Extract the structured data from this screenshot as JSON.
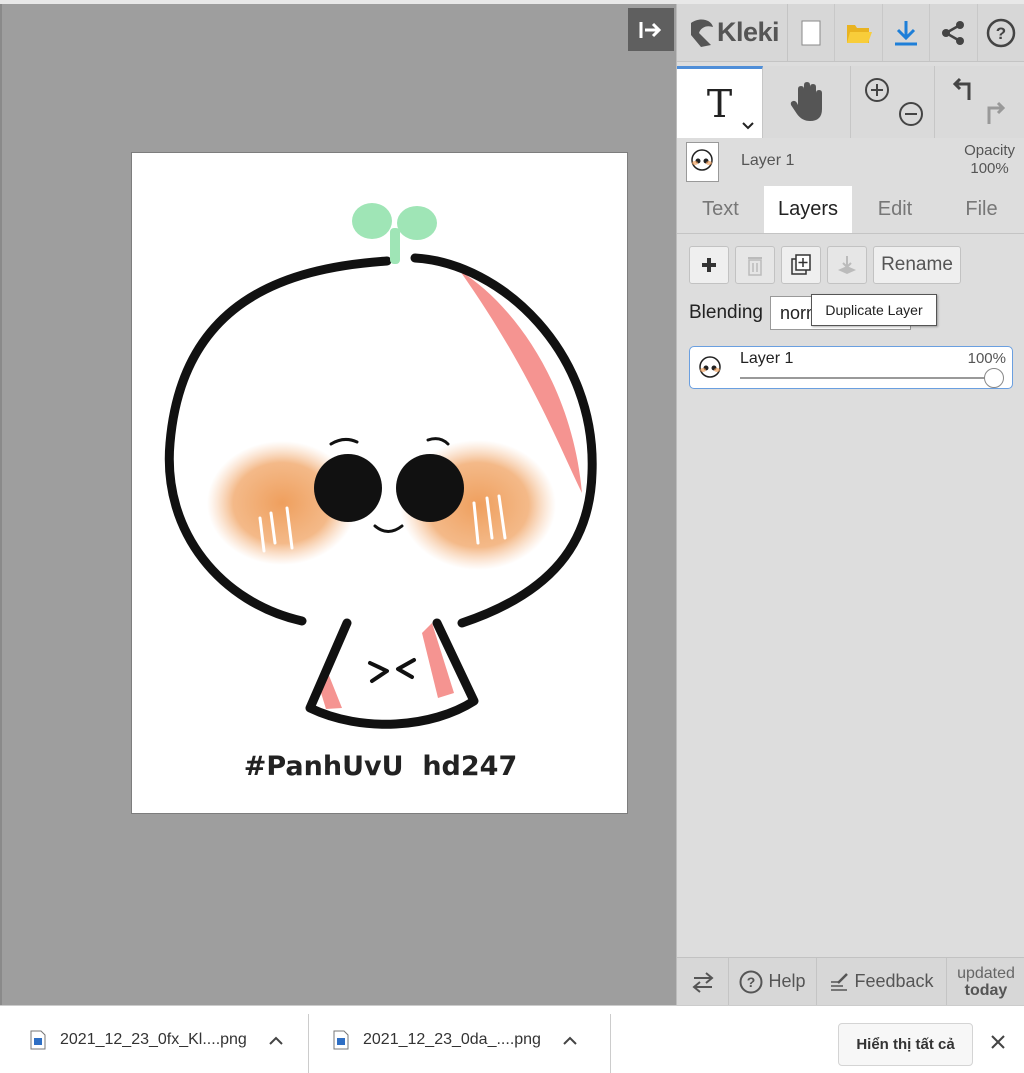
{
  "app": {
    "logo": "Kleki"
  },
  "topbar": {
    "icons": [
      "new-document-icon",
      "open-folder-icon",
      "download-icon",
      "share-icon",
      "help-icon"
    ]
  },
  "canvas": {
    "drawing_text": "#PanhUvU  hd247",
    "colors": {
      "sprout": "#9fe5b6",
      "blush": "#f0a261",
      "accent_pink": "#f59491",
      "outline": "#111111"
    }
  },
  "layer_info": {
    "name": "Layer 1",
    "opacity_label": "Opacity",
    "opacity_value": "100%"
  },
  "tabs": [
    {
      "label": "Text",
      "active": false
    },
    {
      "label": "Layers",
      "active": true
    },
    {
      "label": "Edit",
      "active": false
    },
    {
      "label": "File",
      "active": false
    }
  ],
  "layers_panel": {
    "rename_label": "Rename",
    "blending_label": "Blending",
    "blending_value": "normal",
    "tooltip": "Duplicate Layer",
    "layer": {
      "name": "Layer 1",
      "opacity": "100%"
    }
  },
  "bottom_bar": {
    "help": "Help",
    "feedback": "Feedback",
    "updated_line1": "updated",
    "updated_line2": "today"
  },
  "downloads": {
    "items": [
      {
        "name": "2021_12_23_0fx_Kl....png"
      },
      {
        "name": "2021_12_23_0da_....png"
      }
    ],
    "show_all": "Hiển thị tất cả"
  },
  "accent_color": "#1e7fd8"
}
